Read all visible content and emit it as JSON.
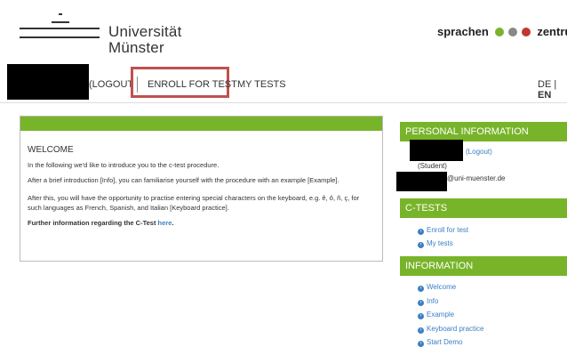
{
  "header": {
    "university": [
      "Universität",
      "Münster"
    ],
    "brand": "sprachen",
    "brand_suffix": "zentrum",
    "brand_dot_colors": [
      "#78b42a",
      "#888888",
      "#c0392b"
    ]
  },
  "nav": {
    "logout": "(LOGOUT)",
    "enroll": "ENROLL FOR TEST",
    "my_tests": "MY TESTS",
    "lang_de": "DE",
    "lang_sep": "|",
    "lang_en": "EN"
  },
  "welcome": {
    "title": "WELCOME",
    "p1": "In the following we'd like to introduce you to the c-test procedure.",
    "p2": "After a brief introduction [Info], you can familiarise yourself with the procedure with an example [Example].",
    "p3": "After this, you will have the opportunity to practise entering special characters on the keyboard, e.g. ê, ô, ñ, ç, for such languages as French, Spanish, and Italian [Keyboard practice].",
    "more_text": "Further information regarding the C-Test",
    "more_link": "here",
    "more_end": "."
  },
  "sidebar": {
    "personal_title": "PERSONAL INFORMATION",
    "logout": "(Logout)",
    "role": "(Student)",
    "email": "@uni-muenster.de",
    "ctests_title": "C-TESTS",
    "ctests": [
      "Enroll for test",
      "My tests"
    ],
    "info_title": "INFORMATION",
    "info": [
      "Welcome",
      "Info",
      "Example",
      "Keyboard practice",
      "Start Demo"
    ]
  },
  "colors": {
    "accent_green": "#78b42a",
    "highlight_red": "#c0504d",
    "link_blue": "#3b7fc4"
  }
}
